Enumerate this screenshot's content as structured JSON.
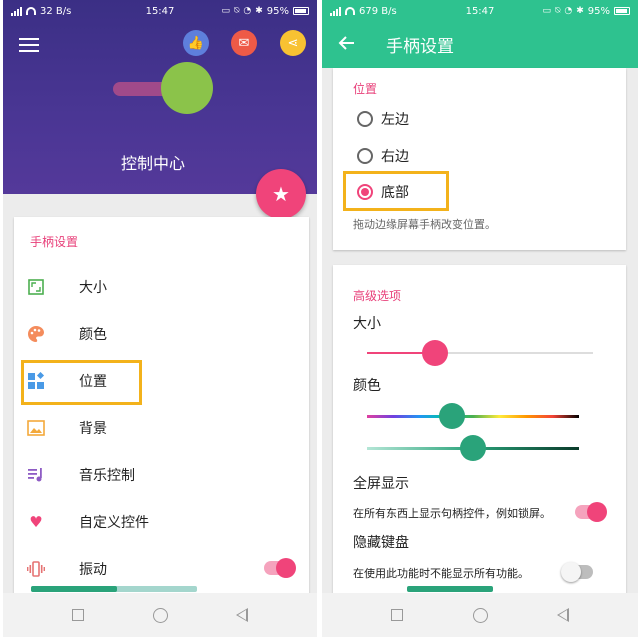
{
  "left": {
    "status": {
      "speed": "32 B/s",
      "time": "15:47",
      "battery": "95%"
    },
    "header": {
      "title": "控制中心"
    },
    "card": {
      "section": "手柄设置",
      "items": [
        {
          "label": "大小",
          "icon": "resize-icon",
          "color": "#4caf50"
        },
        {
          "label": "颜色",
          "icon": "palette-icon",
          "color": "#f48c5c"
        },
        {
          "label": "位置",
          "icon": "position-grid-icon",
          "color": "#4a9ae6"
        },
        {
          "label": "背景",
          "icon": "image-icon",
          "color": "#f3a93b"
        },
        {
          "label": "音乐控制",
          "icon": "music-queue-icon",
          "color": "#8e5cc4"
        },
        {
          "label": "自定义控件",
          "icon": "heart-icon",
          "color": "#f0447a"
        },
        {
          "label": "振动",
          "icon": "vibrate-icon",
          "color": "#e57373"
        }
      ]
    }
  },
  "right": {
    "status": {
      "speed": "679 B/s",
      "time": "15:47",
      "battery": "95%"
    },
    "appbar": {
      "title": "手柄设置"
    },
    "position": {
      "section": "位置",
      "options": [
        "左边",
        "右边",
        "底部"
      ],
      "selected": "底部",
      "hint": "拖动边缘屏幕手柄改变位置。"
    },
    "advanced": {
      "section": "高级选项",
      "size_label": "大小",
      "color_label": "颜色",
      "size_level": 0.3,
      "hue_level": 0.4,
      "shade_level": 0.5,
      "fullscreen_label": "全屏显示",
      "fullscreen_desc": "在所有东西上显示句柄控件，例如锁屏。",
      "fullscreen_on": true,
      "hide_keyboard_label": "隐藏键盘",
      "hide_keyboard_desc": "在使用此功能时不能显示所有功能。",
      "hide_keyboard_on": false
    }
  },
  "colors": {
    "accent": "#f0447a",
    "header_purple": "#4a3694",
    "appbar_green": "#2ec28f",
    "highlight": "#f3b21b"
  }
}
